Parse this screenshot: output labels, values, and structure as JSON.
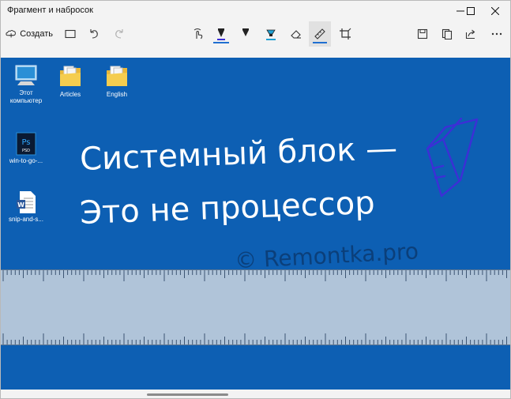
{
  "window": {
    "title": "Фрагмент и набросок"
  },
  "toolbar": {
    "create_label": "Создать"
  },
  "desktop": {
    "icons": [
      {
        "label_line1": "Этот",
        "label_line2": "компьютер",
        "icon": "computer-icon"
      },
      {
        "label_line1": "Articles",
        "icon": "folder-icon"
      },
      {
        "label_line1": "English",
        "icon": "folder-icon"
      },
      {
        "label_line1": "win-to-go-...",
        "icon": "photoshop-file-icon"
      },
      {
        "label_line1": "snip-and-s...",
        "icon": "word-file-icon"
      }
    ]
  },
  "handwriting": {
    "line1": "Системный блок —",
    "line2": "Это не процессор",
    "watermark": "© Remontka.pro"
  },
  "colors": {
    "canvas_bg": "#0d5fb3",
    "ink_white": "#ffffff",
    "ink_purple": "#3c2fd6",
    "ruler": "#b0c4d9",
    "accent": "#1f6fd1"
  }
}
